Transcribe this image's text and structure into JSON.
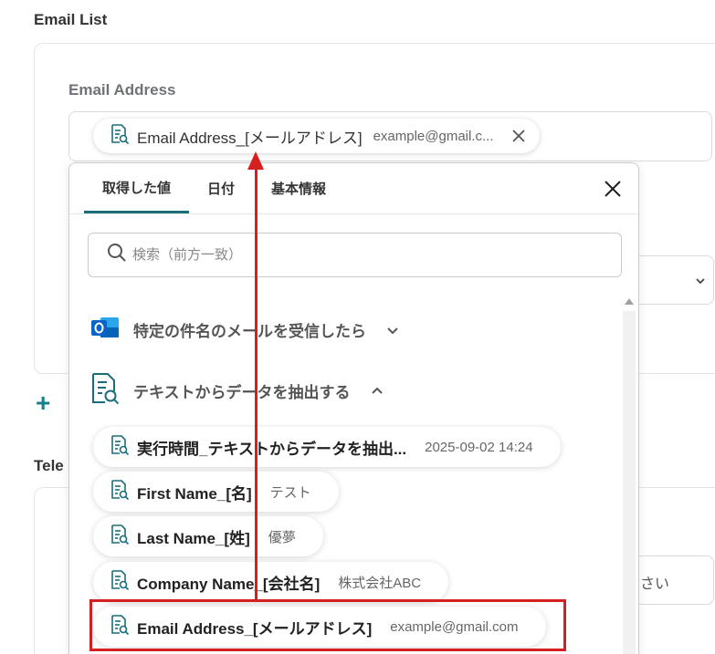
{
  "section": {
    "title": "Email List"
  },
  "email_field": {
    "label": "Email Address",
    "selected_chip": {
      "label": "Email Address_[メールアドレス]",
      "value": "example@gmail.c..."
    }
  },
  "telephone": {
    "label_partial": "Tele"
  },
  "side_input": {
    "partial_text": "さい"
  },
  "dropdown": {
    "tabs": [
      {
        "label": "取得した値",
        "active": true
      },
      {
        "label": "日付",
        "active": false
      },
      {
        "label": "基本情報",
        "active": false
      }
    ],
    "search": {
      "placeholder": "検索（前方一致）"
    },
    "groups": [
      {
        "label": "特定の件名のメールを受信したら",
        "expanded": false,
        "icon": "outlook-icon"
      },
      {
        "label": "テキストからデータを抽出する",
        "expanded": true,
        "icon": "document-search-icon"
      }
    ],
    "items": [
      {
        "label": "実行時間_テキストからデータを抽出...",
        "value": "2025-09-02 14:24"
      },
      {
        "label": "First Name_[名]",
        "value": "テスト"
      },
      {
        "label": "Last Name_[姓]",
        "value": "優夢"
      },
      {
        "label": "Company Name_[会社名]",
        "value": "株式会社ABC"
      },
      {
        "label": "Email Address_[メールアドレス]",
        "value": "example@gmail.com"
      }
    ]
  },
  "colors": {
    "accent": "#1a6e7c",
    "annotation_red": "#d42020",
    "outlook_blue": "#0a64c8"
  }
}
